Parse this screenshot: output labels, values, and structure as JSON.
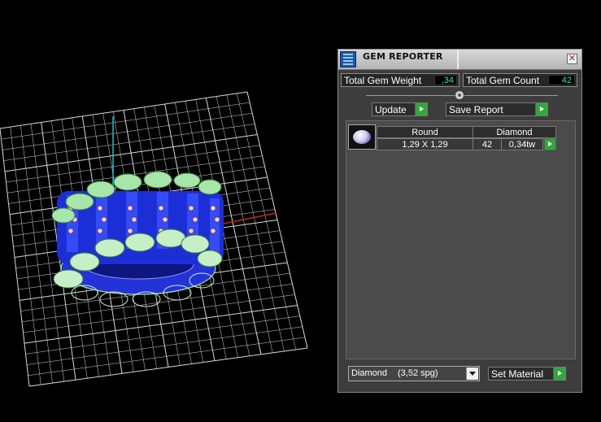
{
  "viewport": {
    "grid_color": "#d9d9d9",
    "axis_colors": {
      "x": "#c42424",
      "z": "#2fb7c9"
    },
    "model_colors": {
      "body": "#1c2fd6",
      "bezel": "#a6e6a8",
      "gem": "#d8d8ee"
    }
  },
  "panel": {
    "title": "GEM REPORTER",
    "close_label": "✕",
    "total_weight_label": "Total Gem Weight",
    "total_weight_value": ",34",
    "total_count_label": "Total Gem Count",
    "total_count_value": "42",
    "update_label": "Update",
    "save_report_label": "Save Report",
    "table": {
      "shape": "Round",
      "material": "Diamond",
      "size": "1,29 X 1,29",
      "count": "42",
      "weight": "0,34tw"
    },
    "material_select": {
      "name": "Diamond",
      "spg": "(3,52 spg)"
    },
    "set_material_label": "Set Material",
    "accent_color": "#30a83a",
    "value_color": "#37e0c8"
  }
}
